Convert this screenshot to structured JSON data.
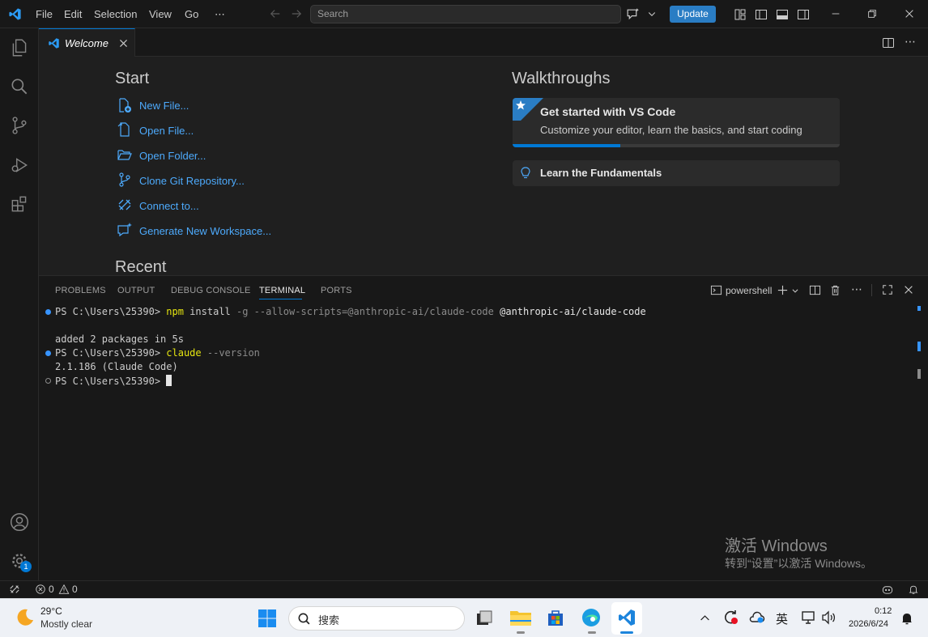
{
  "titlebar": {
    "menu": [
      "File",
      "Edit",
      "Selection",
      "View",
      "Go",
      "⋯"
    ],
    "search_placeholder": "Search",
    "update_label": "Update"
  },
  "tabs": [
    {
      "label": "Welcome",
      "active": true
    }
  ],
  "welcome": {
    "start_title": "Start",
    "start_items": [
      {
        "label": "New File...",
        "icon": "new-file-icon"
      },
      {
        "label": "Open File...",
        "icon": "open-file-icon"
      },
      {
        "label": "Open Folder...",
        "icon": "folder-icon"
      },
      {
        "label": "Clone Git Repository...",
        "icon": "source-control-icon"
      },
      {
        "label": "Connect to...",
        "icon": "remote-icon"
      },
      {
        "label": "Generate New Workspace...",
        "icon": "chat-sparkle-icon"
      }
    ],
    "recent_title": "Recent",
    "walkthroughs_title": "Walkthroughs",
    "walkthroughs": [
      {
        "title": "Get started with VS Code",
        "description": "Customize your editor, learn the basics, and start coding",
        "progress": 0.33
      },
      {
        "title": "Learn the Fundamentals"
      }
    ]
  },
  "panel": {
    "tabs": [
      "PROBLEMS",
      "OUTPUT",
      "DEBUG CONSOLE",
      "TERMINAL",
      "PORTS"
    ],
    "active_tab": "TERMINAL",
    "shell_label": "powershell",
    "terminal": {
      "prompt": "PS C:\\Users\\25390> ",
      "cmd1_bin": "npm",
      "cmd1_rest": " install ",
      "cmd1_flag": "-g --allow-scripts=@anthropic-ai/claude-code",
      "cmd1_pkg": " @anthropic-ai/claude-code",
      "output1": "added 2 packages in 5s",
      "cmd2_bin": "claude",
      "cmd2_flag": " --version",
      "output2": "2.1.186 (Claude Code)"
    }
  },
  "watermark": {
    "title": "激活 Windows",
    "subtitle": "转到“设置”以激活 Windows。"
  },
  "statusbar": {
    "errors": "0",
    "warnings": "0"
  },
  "taskbar": {
    "weather_temp": "29°C",
    "weather_desc": "Mostly clear",
    "search_placeholder": "搜索",
    "ime": "英",
    "time": "0:12",
    "date": "2026/6/24",
    "settings_badge": "1"
  },
  "colors": {
    "accent": "#0078d4",
    "link": "#4daafc",
    "update_button": "#2a7dc4"
  }
}
